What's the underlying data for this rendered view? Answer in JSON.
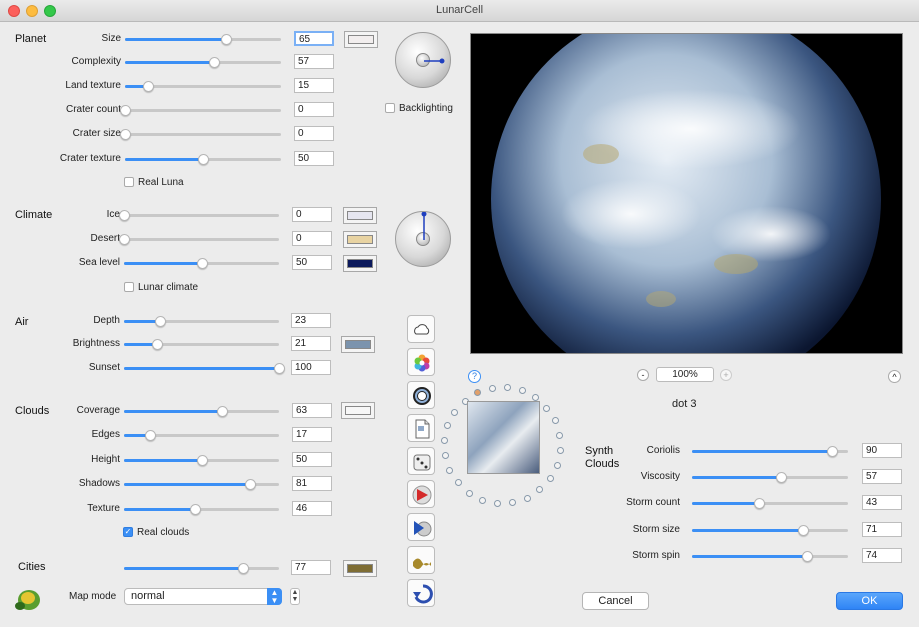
{
  "window": {
    "title": "LunarCell"
  },
  "planet": {
    "title": "Planet",
    "sliders": [
      {
        "label": "Size",
        "value": 65
      },
      {
        "label": "Complexity",
        "value": 57
      },
      {
        "label": "Land texture",
        "value": 15
      },
      {
        "label": "Crater count",
        "value": 0
      },
      {
        "label": "Crater size",
        "value": 0
      },
      {
        "label": "Crater texture",
        "value": 50
      }
    ],
    "size_color": "#f2eeee",
    "real_luna": {
      "label": "Real Luna",
      "checked": false
    },
    "backlighting": {
      "label": "Backlighting",
      "checked": false
    }
  },
  "climate": {
    "title": "Climate",
    "sliders": [
      {
        "label": "Ice",
        "value": 0,
        "color": "#e6e6f0"
      },
      {
        "label": "Desert",
        "value": 0,
        "color": "#e8d3a2"
      },
      {
        "label": "Sea level",
        "value": 50,
        "color": "#0c1a5c"
      }
    ],
    "lunar_climate": {
      "label": "Lunar climate",
      "checked": false
    }
  },
  "air": {
    "title": "Air",
    "sliders": [
      {
        "label": "Depth",
        "value": 23
      },
      {
        "label": "Brightness",
        "value": 21
      },
      {
        "label": "Sunset",
        "value": 100
      }
    ],
    "color": "#7b93ad"
  },
  "clouds": {
    "title": "Clouds",
    "sliders": [
      {
        "label": "Coverage",
        "value": 63
      },
      {
        "label": "Edges",
        "value": 17
      },
      {
        "label": "Height",
        "value": 50
      },
      {
        "label": "Shadows",
        "value": 81
      },
      {
        "label": "Texture",
        "value": 46
      }
    ],
    "color": "#f7f7f7",
    "real_clouds": {
      "label": "Real clouds",
      "checked": true
    }
  },
  "cities": {
    "title": "Cities",
    "value": 77,
    "color": "#7e6d34"
  },
  "map_mode": {
    "label": "Map mode",
    "selected": "normal"
  },
  "toolbar_icons": [
    "cloud-icon",
    "color-wheel-icon",
    "ring-icon",
    "document-icon",
    "dice-icon",
    "red-arrow-icon",
    "play-disc-icon",
    "gradient-wave-icon",
    "undo-icon"
  ],
  "preview": {
    "zoom": "100%",
    "help": "?",
    "zoom_out": "-",
    "zoom_in": "+",
    "expand": "^",
    "caption": "dot 3"
  },
  "synth_clouds": {
    "title_line1": "Synth",
    "title_line2": "Clouds",
    "sliders": [
      {
        "label": "Coriolis",
        "value": 90
      },
      {
        "label": "Viscosity",
        "value": 57
      },
      {
        "label": "Storm count",
        "value": 43
      },
      {
        "label": "Storm size",
        "value": 71
      },
      {
        "label": "Storm spin",
        "value": 74
      }
    ]
  },
  "buttons": {
    "cancel": "Cancel",
    "ok": "OK"
  },
  "colors": {
    "accent": "#3b8ff5"
  }
}
